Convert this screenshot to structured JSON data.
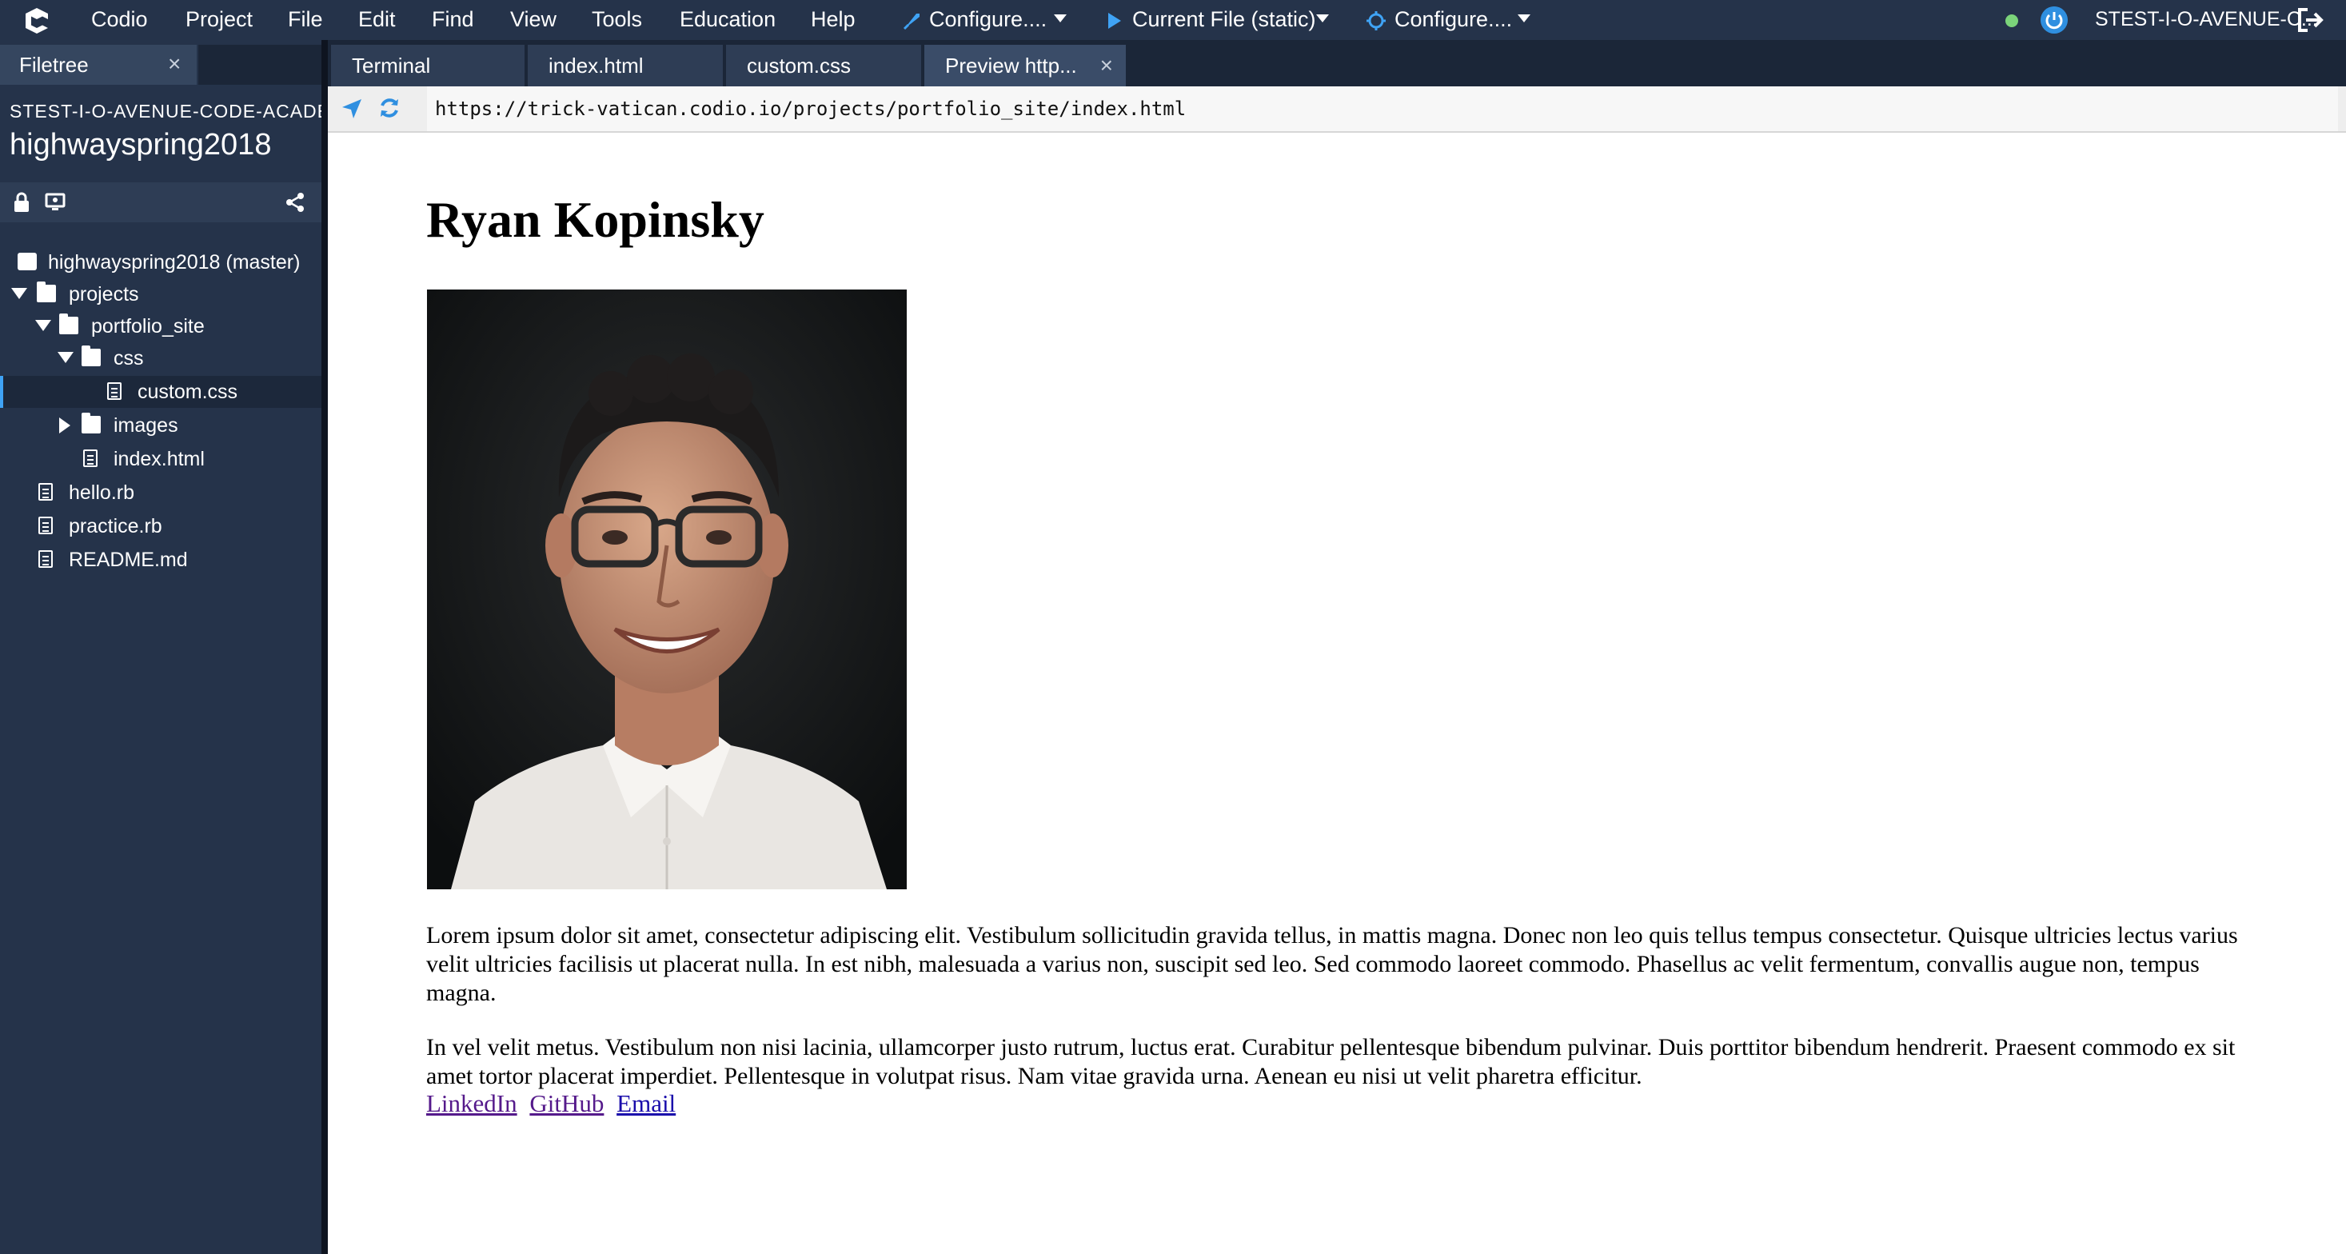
{
  "menubar": {
    "items": [
      "Codio",
      "Project",
      "File",
      "Edit",
      "Find",
      "View",
      "Tools",
      "Education",
      "Help"
    ],
    "configure_deploy": "Configure....",
    "run_target": "Current File (static)",
    "configure_preview": "Configure....",
    "user": "STEST-I-O-AVENUE-C..."
  },
  "sidebar": {
    "tab_label": "Filetree",
    "workspace": "STEST-I-O-AVENUE-CODE-ACADEMY",
    "project": "highwayspring2018",
    "tree": [
      {
        "label": "highwayspring2018 (master)",
        "type": "repo"
      },
      {
        "label": "projects",
        "type": "folder",
        "open": true
      },
      {
        "label": "portfolio_site",
        "type": "folder",
        "open": true
      },
      {
        "label": "css",
        "type": "folder",
        "open": true
      },
      {
        "label": "custom.css",
        "type": "file",
        "selected": true
      },
      {
        "label": "images",
        "type": "folder",
        "open": false
      },
      {
        "label": "index.html",
        "type": "file"
      },
      {
        "label": "hello.rb",
        "type": "file"
      },
      {
        "label": "practice.rb",
        "type": "file"
      },
      {
        "label": "README.md",
        "type": "file"
      }
    ]
  },
  "editor_tabs": [
    {
      "label": "Terminal",
      "active": false
    },
    {
      "label": "index.html",
      "active": false
    },
    {
      "label": "custom.css",
      "active": false
    },
    {
      "label": "Preview http...",
      "active": true
    }
  ],
  "preview": {
    "url": "https://trick-vatican.codio.io/projects/portfolio_site/index.html",
    "heading": "Ryan Kopinsky",
    "paragraph1": "Lorem ipsum dolor sit amet, consectetur adipiscing elit. Vestibulum sollicitudin gravida tellus, in mattis magna. Donec non leo quis tellus tempus consectetur. Quisque ultricies lectus varius velit ultricies facilisis ut placerat nulla. In est nibh, malesuada a varius non, suscipit sed leo. Sed commodo laoreet commodo. Phasellus ac velit fermentum, convallis augue non, tempus magna.",
    "paragraph2": "In vel velit metus. Vestibulum non nisi lacinia, ullamcorper justo rutrum, luctus erat. Curabitur pellentesque bibendum pulvinar. Duis porttitor bibendum hendrerit. Praesent commodo ex sit amet tortor placerat imperdiet. Pellentesque in volutpat risus. Nam vitae gravida urna. Aenean eu nisi ut velit pharetra efficitur.",
    "links": [
      "LinkedIn",
      "GitHub",
      "Email"
    ]
  },
  "colors": {
    "chrome_dark": "#25334a",
    "tab_active": "#3a4c68",
    "accent_blue": "#3fa3f5",
    "status_green": "#7bd47a",
    "link": "#1a0dab",
    "link_visited": "#551a8b"
  }
}
